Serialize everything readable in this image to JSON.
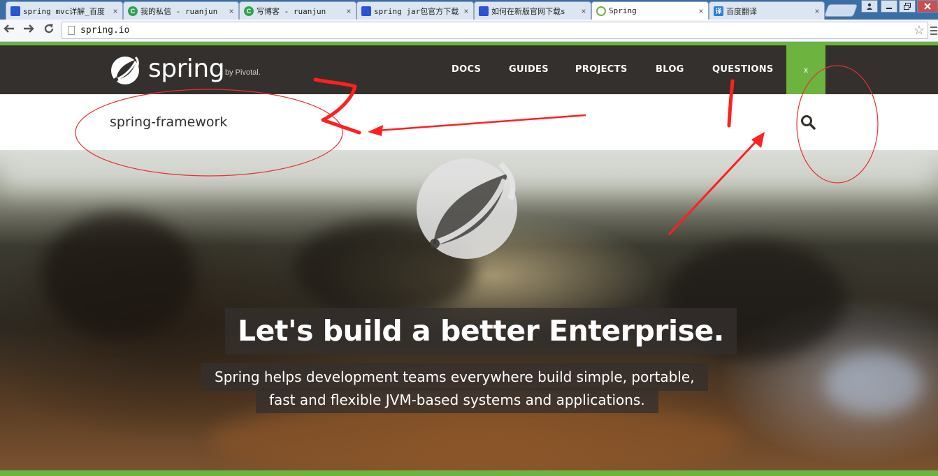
{
  "browser": {
    "tabs": [
      {
        "title": "spring mvc详解_百度",
        "icon": "paw-icon"
      },
      {
        "title": "我的私信 - ruanjun",
        "icon": "csdn-icon"
      },
      {
        "title": "写博客 - ruanjun",
        "icon": "csdn-icon"
      },
      {
        "title": "spring jar包官方下载",
        "icon": "paw-icon"
      },
      {
        "title": "如何在新版官网下载s",
        "icon": "paw-icon"
      },
      {
        "title": "Spring",
        "icon": "spring-leaf-icon",
        "active": true
      },
      {
        "title": "百度翻译",
        "icon": "translate-icon",
        "favicon_text": "译"
      }
    ],
    "tab_close_glyph": "×",
    "url": "spring.io"
  },
  "site": {
    "logo_text": "spring",
    "logo_byline": "by Pivotal.",
    "nav": [
      "DOCS",
      "GUIDES",
      "PROJECTS",
      "BLOG",
      "QUESTIONS"
    ],
    "close_label": "x",
    "brand_color": "#6db33f",
    "header_color": "#34302d"
  },
  "search": {
    "value": "spring-framework"
  },
  "hero": {
    "title": "Let's build a better Enterprise.",
    "subtitle_line1": "Spring helps development teams everywhere build simple, portable,",
    "subtitle_line2": "fast and flexible JVM-based systems and applications."
  },
  "annotations": {
    "color": "#ff2020",
    "labels": [
      "2",
      "1"
    ]
  }
}
